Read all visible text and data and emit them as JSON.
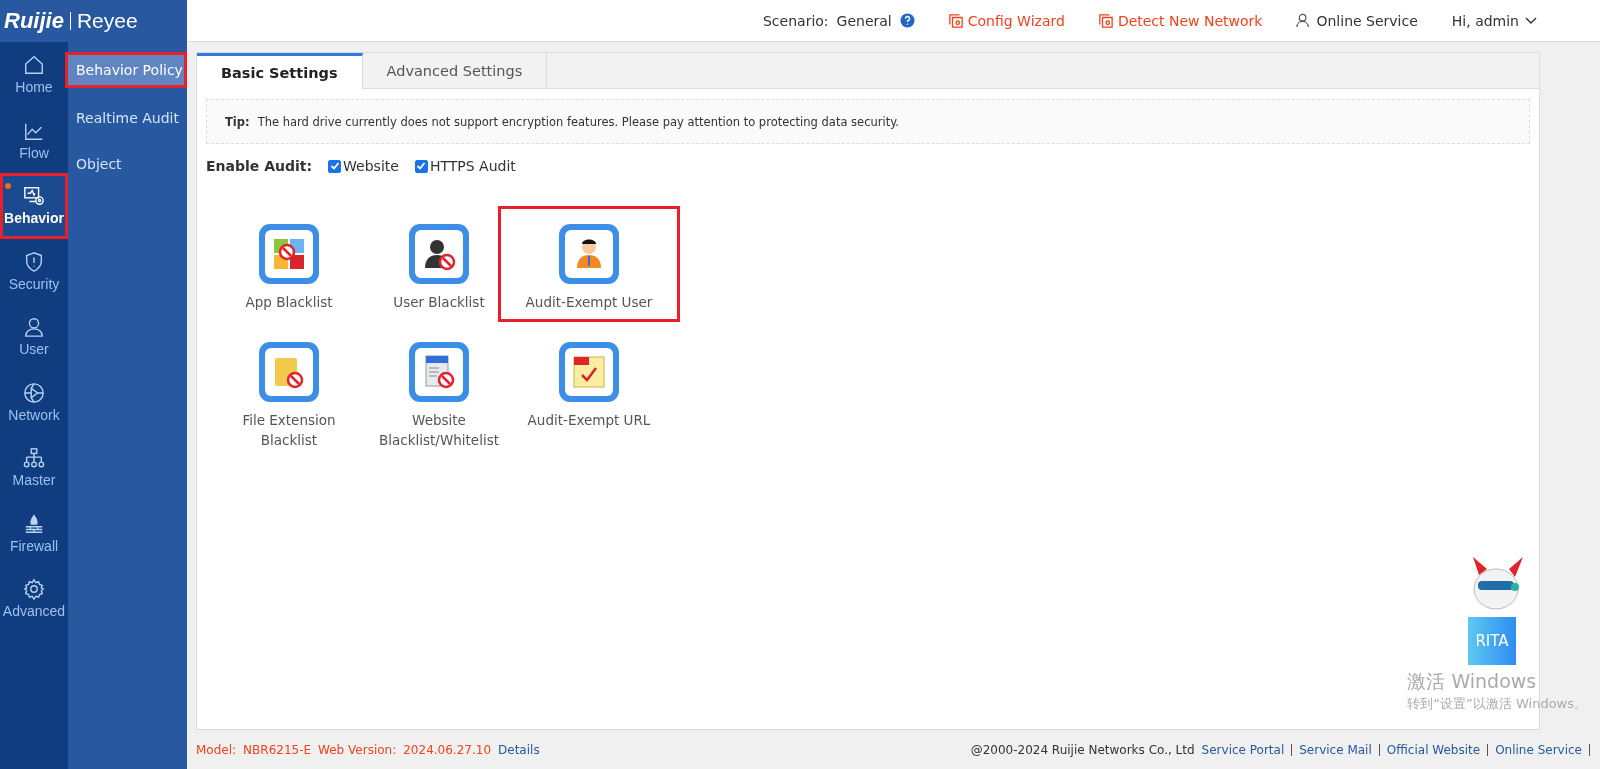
{
  "logo": {
    "brand": "Ruijie",
    "product": "Reyee"
  },
  "topbar": {
    "scenario_label": "Scenario:",
    "scenario_value": "General",
    "links": [
      {
        "kind": "wizard",
        "label": "Config Wizard"
      },
      {
        "kind": "detect",
        "label": "Detect New Network"
      },
      {
        "kind": "service",
        "label": "Online Service"
      }
    ],
    "user": "Hi, admin"
  },
  "nav": [
    {
      "kind": "home",
      "label": "Home",
      "selected": false,
      "highlighted": false,
      "notified": false
    },
    {
      "kind": "flow",
      "label": "Flow",
      "selected": false,
      "highlighted": false,
      "notified": false
    },
    {
      "kind": "behavior",
      "label": "Behavior",
      "selected": true,
      "highlighted": true,
      "notified": true
    },
    {
      "kind": "security",
      "label": "Security",
      "selected": false,
      "highlighted": false,
      "notified": false
    },
    {
      "kind": "user",
      "label": "User",
      "selected": false,
      "highlighted": false,
      "notified": false
    },
    {
      "kind": "network",
      "label": "Network",
      "selected": false,
      "highlighted": false,
      "notified": false
    },
    {
      "kind": "master",
      "label": "Master",
      "selected": false,
      "highlighted": false,
      "notified": false
    },
    {
      "kind": "firewall",
      "label": "Firewall",
      "selected": false,
      "highlighted": false,
      "notified": false
    },
    {
      "kind": "advanced",
      "label": "Advanced",
      "selected": false,
      "highlighted": false,
      "notified": false
    }
  ],
  "submenu": [
    {
      "label": "Behavior Policy",
      "selected": true,
      "highlighted": true
    },
    {
      "label": "Realtime Audit",
      "selected": false,
      "highlighted": false
    },
    {
      "label": "Object",
      "selected": false,
      "highlighted": false
    }
  ],
  "tabs": [
    {
      "label": "Basic Settings",
      "selected": true
    },
    {
      "label": "Advanced Settings",
      "selected": false
    }
  ],
  "tip": {
    "label": "Tip:",
    "text": "The hard drive currently does not support encryption features. Please pay attention to protecting data security."
  },
  "enable_audit": {
    "label": "Enable Audit:",
    "options": [
      {
        "label": "Website",
        "checked": true
      },
      {
        "label": "HTTPS Audit",
        "checked": true
      }
    ]
  },
  "tiles": [
    {
      "kind": "app",
      "label": "App Blacklist",
      "highlighted": false
    },
    {
      "kind": "user-block",
      "label": "User Blacklist",
      "highlighted": false
    },
    {
      "kind": "user-exempt",
      "label": "Audit-Exempt User",
      "highlighted": true
    },
    {
      "kind": "file",
      "label": "File Extension Blacklist",
      "highlighted": false
    },
    {
      "kind": "website",
      "label": "Website Blacklist/Whitelist",
      "highlighted": false
    },
    {
      "kind": "url",
      "label": "Audit-Exempt URL",
      "highlighted": false
    }
  ],
  "assistant": {
    "label": "RITA"
  },
  "os_notice": {
    "title": "激活 Windows",
    "text": "转到“设置”以激活 Windows。"
  },
  "footer": {
    "model_label": "Model:",
    "model": "NBR6215-E",
    "version_label": "Web Version:",
    "version": "2024.06.27.10",
    "details": "Details",
    "copyright": "@2000-2024 Ruijie Networks Co., Ltd",
    "links": [
      "Service Portal",
      "Service Mail",
      "Official Website",
      "Online Service"
    ]
  }
}
